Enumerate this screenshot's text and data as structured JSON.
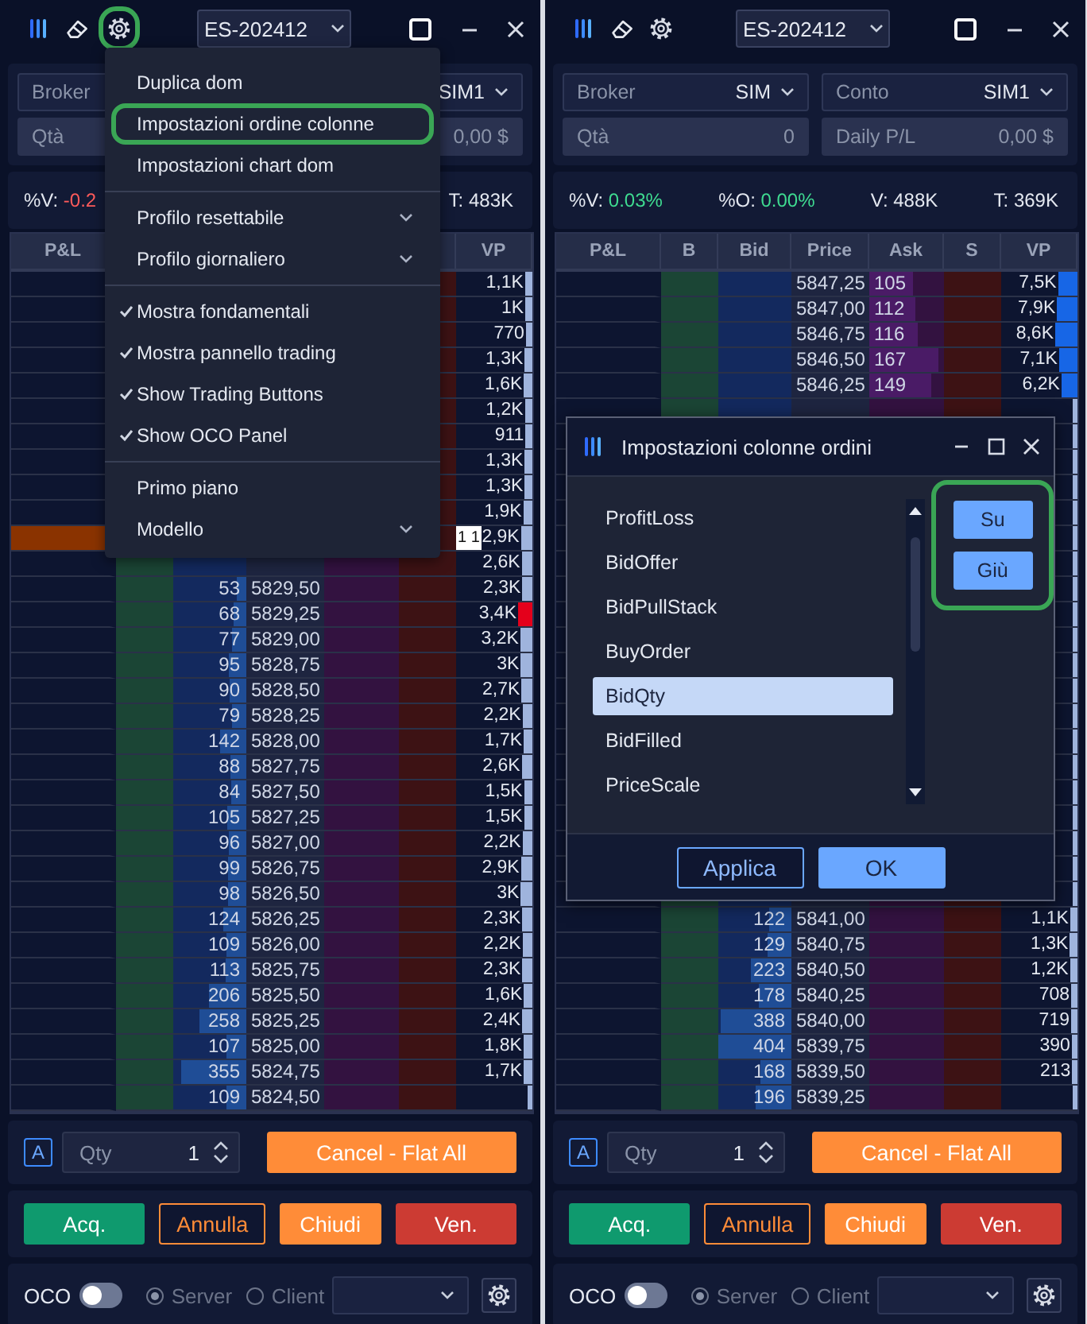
{
  "panels": [
    {
      "toolbar": {
        "tools": [
          {
            "kind": "logo",
            "highlighted": false
          },
          {
            "kind": "eraser",
            "highlighted": false
          },
          {
            "kind": "settings",
            "highlighted": true
          }
        ],
        "symbol": "ES-202412"
      },
      "account": [
        {
          "kind": "select",
          "label": "Broker"
        },
        {
          "kind": "select",
          "value": "SIM1"
        },
        {
          "kind": "display",
          "label": "Qtà"
        },
        {
          "kind": "display",
          "value": "0,00 $"
        }
      ],
      "stats": [
        {
          "label": "%V:",
          "value": "-0.2",
          "color": "#ff5b5b"
        },
        {
          "label": "T:",
          "value": "483K",
          "color": "#e4e8f0"
        }
      ],
      "columns": [
        {
          "label": "P&L"
        },
        {},
        {},
        {},
        {},
        {},
        {
          "label": "VP"
        }
      ],
      "rows": [
        {
          "vp": "1,1K"
        },
        {
          "vp": "1K"
        },
        {
          "vp": "770"
        },
        {
          "vp": "1,3K"
        },
        {
          "vp": "1,6K"
        },
        {
          "vp": "1,2K"
        },
        {
          "vp": "911"
        },
        {
          "vp": "1,3K"
        },
        {
          "vp": "1,3K"
        },
        {
          "vp": "1,9K"
        },
        {
          "vp": "2,9K",
          "position": true,
          "tag": "1 1"
        },
        {
          "vp": "2,6K"
        },
        {
          "bid": "53",
          "price": "5829,50",
          "vp": "2,3K"
        },
        {
          "bid": "68",
          "price": "5829,25",
          "vp": "3,4K",
          "max_volume": true
        },
        {
          "bid": "77",
          "price": "5829,00",
          "vp": "3,2K"
        },
        {
          "bid": "95",
          "price": "5828,75",
          "vp": "3K"
        },
        {
          "bid": "90",
          "price": "5828,50",
          "vp": "2,7K"
        },
        {
          "bid": "79",
          "price": "5828,25",
          "vp": "2,2K"
        },
        {
          "bid": "142",
          "price": "5828,00",
          "vp": "1,7K"
        },
        {
          "bid": "88",
          "price": "5827,75",
          "vp": "2,6K"
        },
        {
          "bid": "84",
          "price": "5827,50",
          "vp": "1,5K"
        },
        {
          "bid": "105",
          "price": "5827,25",
          "vp": "1,5K"
        },
        {
          "bid": "96",
          "price": "5827,00",
          "vp": "2,2K"
        },
        {
          "bid": "99",
          "price": "5826,75",
          "vp": "2,9K"
        },
        {
          "bid": "98",
          "price": "5826,50",
          "vp": "3K"
        },
        {
          "bid": "124",
          "price": "5826,25",
          "vp": "2,3K"
        },
        {
          "bid": "109",
          "price": "5826,00",
          "vp": "2,2K"
        },
        {
          "bid": "113",
          "price": "5825,75",
          "vp": "2,3K"
        },
        {
          "bid": "206",
          "price": "5825,50",
          "vp": "1,6K"
        },
        {
          "bid": "258",
          "price": "5825,25",
          "vp": "2,4K"
        },
        {
          "bid": "107",
          "price": "5825,00",
          "vp": "1,8K"
        },
        {
          "bid": "355",
          "price": "5824,75",
          "vp": "1,7K"
        },
        {
          "bid": "109",
          "price": "5824,50"
        }
      ],
      "menu": {
        "sections": [
          [
            {
              "label": "Duplica dom",
              "kind": "action",
              "highlighted": false
            },
            {
              "label": "Impostazioni ordine colonne",
              "kind": "action",
              "highlighted": true
            },
            {
              "label": "Impostazioni chart dom",
              "kind": "action",
              "highlighted": false
            }
          ],
          [
            {
              "label": "Profilo resettabile",
              "kind": "submenu",
              "highlighted": false
            },
            {
              "label": "Profilo giornaliero",
              "kind": "submenu",
              "highlighted": false
            }
          ],
          [
            {
              "label": "Mostra fondamentali",
              "kind": "check",
              "checked": true,
              "highlighted": false
            },
            {
              "label": "Mostra pannello trading",
              "kind": "check",
              "checked": true,
              "highlighted": false
            },
            {
              "label": "Show Trading Buttons",
              "kind": "check",
              "checked": true,
              "highlighted": false
            },
            {
              "label": "Show OCO Panel",
              "kind": "check",
              "checked": true,
              "highlighted": false
            }
          ],
          [
            {
              "label": "Primo piano",
              "kind": "action",
              "highlighted": false
            },
            {
              "label": "Modello",
              "kind": "submenu",
              "highlighted": false
            }
          ]
        ]
      },
      "order": {
        "mode": "A",
        "qty": {
          "label": "Qty",
          "value": "1"
        },
        "flatten": "Cancel - Flat All",
        "actions": [
          {
            "label": "Acq.",
            "kind": "buy"
          },
          {
            "label": "Annulla",
            "kind": "cancel"
          },
          {
            "label": "Chiudi",
            "kind": "close"
          },
          {
            "label": "Ven.",
            "kind": "sell"
          }
        ],
        "oco": {
          "label": "OCO",
          "on": false,
          "modes": [
            {
              "label": "Server",
              "selected": true
            },
            {
              "label": "Client",
              "selected": false
            }
          ]
        }
      }
    },
    {
      "toolbar": {
        "tools": [
          {
            "kind": "logo",
            "highlighted": false
          },
          {
            "kind": "eraser",
            "highlighted": false
          },
          {
            "kind": "settings",
            "highlighted": false
          }
        ],
        "symbol": "ES-202412"
      },
      "account": [
        {
          "kind": "select",
          "label": "Broker",
          "value": "SIM"
        },
        {
          "kind": "select",
          "label": "Conto",
          "value": "SIM1"
        },
        {
          "kind": "display",
          "label": "Qtà",
          "value": "0"
        },
        {
          "kind": "display",
          "label": "Daily P/L",
          "value": "0,00 $"
        }
      ],
      "stats": [
        {
          "label": "%V:",
          "value": "0.03%",
          "color": "#3fdc91"
        },
        {
          "label": "%O:",
          "value": "0.00%",
          "color": "#3fdc91"
        },
        {
          "label": "V:",
          "value": "488K",
          "color": "#e4e8f0"
        },
        {
          "label": "T:",
          "value": "369K",
          "color": "#e4e8f0"
        }
      ],
      "columns": [
        {
          "label": "P&L"
        },
        {
          "label": "B"
        },
        {
          "label": "Bid"
        },
        {
          "label": "Price"
        },
        {
          "label": "Ask"
        },
        {
          "label": "S"
        },
        {
          "label": "VP"
        }
      ],
      "rows": [
        {
          "price": "5847,25",
          "ask": "105",
          "vp": "7,5K",
          "value_area": true
        },
        {
          "price": "5847,00",
          "ask": "112",
          "vp": "7,9K",
          "value_area": true
        },
        {
          "price": "5846,75",
          "ask": "116",
          "vp": "8,6K",
          "value_area": true
        },
        {
          "price": "5846,50",
          "ask": "167",
          "vp": "7,1K",
          "value_area": true
        },
        {
          "price": "5846,25",
          "ask": "149",
          "vp": "6,2K",
          "value_area": true
        },
        {},
        {},
        {},
        {},
        {},
        {},
        {},
        {},
        {},
        {},
        {},
        {},
        {},
        {},
        {},
        {},
        {},
        {},
        {},
        {},
        {
          "bid": "122",
          "price": "5841,00",
          "vp": "1,1K"
        },
        {
          "bid": "129",
          "price": "5840,75",
          "vp": "1,3K"
        },
        {
          "bid": "223",
          "price": "5840,50",
          "vp": "1,2K"
        },
        {
          "bid": "178",
          "price": "5840,25",
          "vp": "708"
        },
        {
          "bid": "388",
          "price": "5840,00",
          "vp": "719"
        },
        {
          "bid": "404",
          "price": "5839,75",
          "vp": "390"
        },
        {
          "bid": "168",
          "price": "5839,50",
          "vp": "213"
        },
        {
          "bid": "196",
          "price": "5839,25"
        }
      ],
      "dialog": {
        "title": "Impostazioni colonne ordini",
        "items": [
          {
            "label": "ProfitLoss",
            "selected": false
          },
          {
            "label": "BidOffer",
            "selected": false
          },
          {
            "label": "BidPullStack",
            "selected": false
          },
          {
            "label": "BuyOrder",
            "selected": false
          },
          {
            "label": "BidQty",
            "selected": true
          },
          {
            "label": "BidFilled",
            "selected": false
          },
          {
            "label": "PriceScale",
            "selected": false
          }
        ],
        "move_buttons": [
          "Su",
          "Giù"
        ],
        "move_buttons_highlighted": true,
        "footer": [
          {
            "label": "Applica",
            "kind": "secondary"
          },
          {
            "label": "OK",
            "kind": "primary"
          }
        ]
      },
      "order": {
        "mode": "A",
        "qty": {
          "label": "Qty",
          "value": "1"
        },
        "flatten": "Cancel - Flat All",
        "actions": [
          {
            "label": "Acq.",
            "kind": "buy"
          },
          {
            "label": "Annulla",
            "kind": "cancel"
          },
          {
            "label": "Chiudi",
            "kind": "close"
          },
          {
            "label": "Ven.",
            "kind": "sell"
          }
        ],
        "oco": {
          "label": "OCO",
          "on": false,
          "modes": [
            {
              "label": "Server",
              "selected": true
            },
            {
              "label": "Client",
              "selected": false
            }
          ]
        }
      }
    }
  ]
}
